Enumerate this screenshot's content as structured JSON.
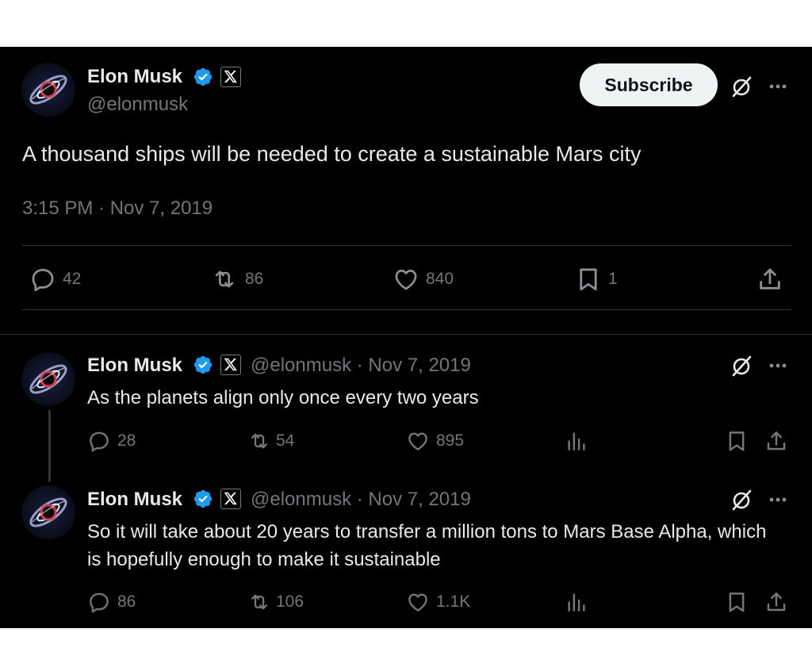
{
  "main_tweet": {
    "author_name": "Elon Musk",
    "handle": "@elonmusk",
    "subscribe_label": "Subscribe",
    "text": "A thousand ships will be needed to create a sustainable Mars city",
    "timestamp": "3:15 PM · Nov 7, 2019",
    "replies": "42",
    "reposts": "86",
    "likes": "840",
    "bookmarks": "1"
  },
  "replies": [
    {
      "author_name": "Elon Musk",
      "handle_date": "@elonmusk · Nov 7, 2019",
      "text": "As the planets align only once every two years",
      "replies": "28",
      "reposts": "54",
      "likes": "895"
    },
    {
      "author_name": "Elon Musk",
      "handle_date": "@elonmusk · Nov 7, 2019",
      "text": "So it will take about 20 years to transfer a million tons to Mars Base Alpha, which is hopefully enough to make it sustainable",
      "replies": "86",
      "reposts": "106",
      "likes": "1.1K"
    }
  ],
  "icons": {
    "verified": "verified-badge-icon",
    "affiliate": "x-logo-icon",
    "grok": "grok-icon",
    "more": "more-icon",
    "reply": "reply-icon",
    "repost": "repost-icon",
    "like": "heart-icon",
    "bookmark": "bookmark-icon",
    "share": "share-icon",
    "views": "views-icon"
  },
  "colors": {
    "background": "#000000",
    "text": "#e7e9ea",
    "muted": "#71767b",
    "verified": "#1d9bf0",
    "divider": "#2f3336"
  }
}
